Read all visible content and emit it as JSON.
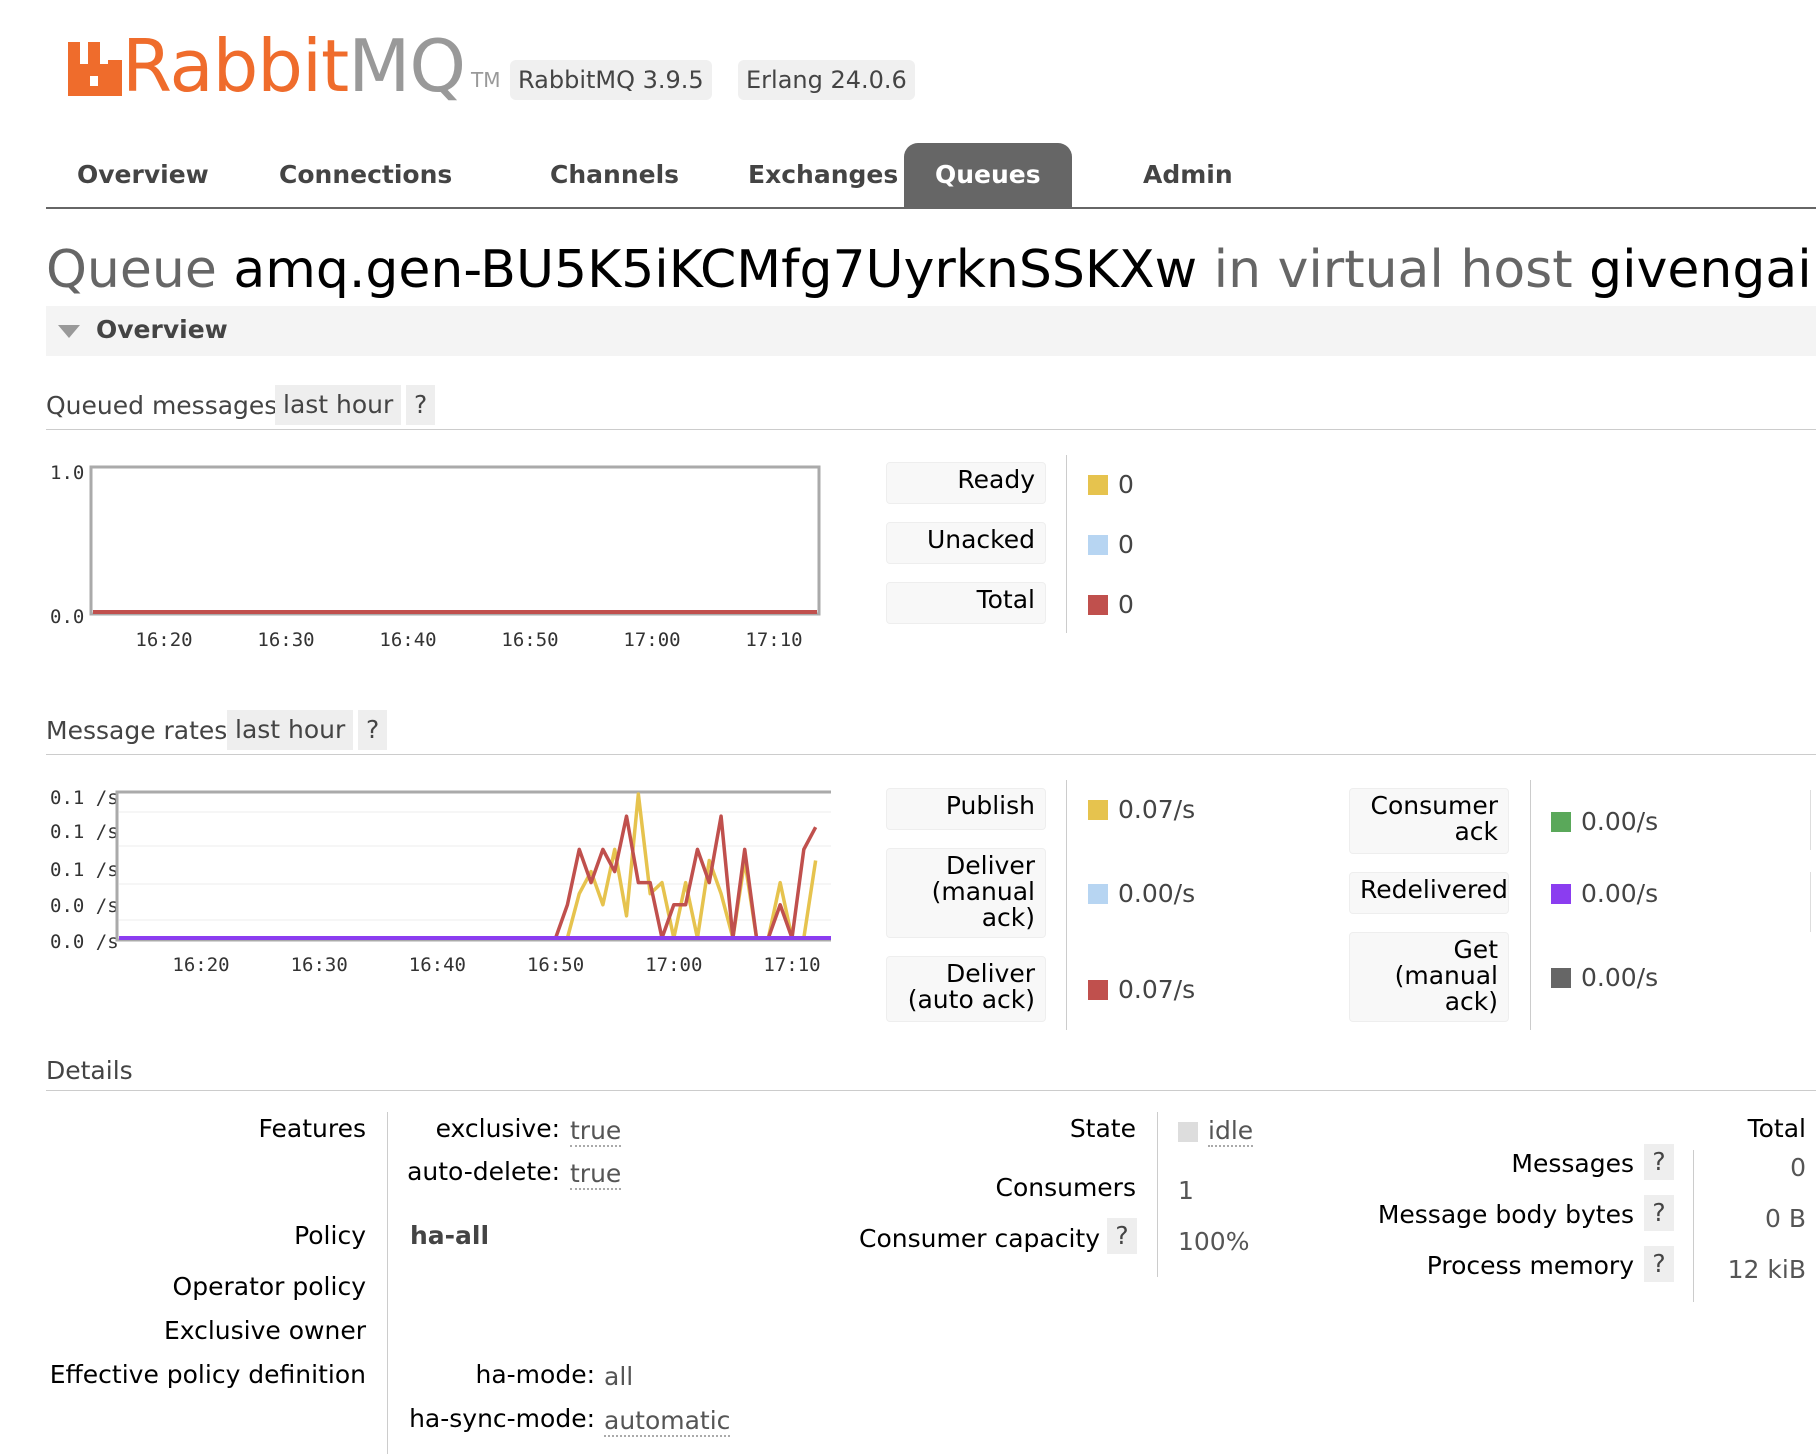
{
  "header": {
    "logo_rabbit": "Rabbit",
    "logo_mq": "MQ",
    "logo_tm": "TM",
    "rabbitmq_version": "RabbitMQ 3.9.5",
    "erlang_version": "Erlang 24.0.6"
  },
  "tabs": [
    {
      "label": "Overview"
    },
    {
      "label": "Connections"
    },
    {
      "label": "Channels"
    },
    {
      "label": "Exchanges"
    },
    {
      "label": "Queues",
      "active": true
    },
    {
      "label": "Admin"
    }
  ],
  "title": {
    "prefix": "Queue",
    "queue_name": "amq.gen-BU5K5iKCMfg7UyrknSSKXw",
    "middle": "in virtual host",
    "vhost": "givengain"
  },
  "section": {
    "label": "Overview"
  },
  "queued": {
    "label": "Queued messages",
    "range": "last hour",
    "help": "?",
    "legend": [
      {
        "label": "Ready",
        "value": "0",
        "color": "#e6c34e"
      },
      {
        "label": "Unacked",
        "value": "0",
        "color": "#b7d5f2"
      },
      {
        "label": "Total",
        "value": "0",
        "color": "#c0504d"
      }
    ]
  },
  "rates": {
    "label": "Message rates",
    "range": "last hour",
    "help": "?",
    "legend_left": [
      {
        "label": "Publish",
        "value": "0.07/s",
        "color": "#e6c34e"
      },
      {
        "label": "Deliver (manual ack)",
        "value": "0.00/s",
        "color": "#b7d5f2"
      },
      {
        "label": "Deliver (auto ack)",
        "value": "0.07/s",
        "color": "#c0504d"
      }
    ],
    "legend_right": [
      {
        "label": "Consumer ack",
        "value": "0.00/s",
        "color": "#5aa85a"
      },
      {
        "label": "Redelivered",
        "value": "0.00/s",
        "color": "#8b3df0"
      },
      {
        "label": "Get (manual ack)",
        "value": "0.00/s",
        "color": "#666666"
      }
    ]
  },
  "chart_data": [
    {
      "type": "line",
      "title": "Queued messages",
      "x": [
        "16:20",
        "16:30",
        "16:40",
        "16:50",
        "17:00",
        "17:10"
      ],
      "y_ticks": [
        "1.0",
        "0.0"
      ],
      "ylim": [
        0,
        1
      ],
      "series": [
        {
          "name": "Ready",
          "color": "#e6c34e",
          "values": [
            0,
            0,
            0,
            0,
            0,
            0
          ]
        },
        {
          "name": "Unacked",
          "color": "#b7d5f2",
          "values": [
            0,
            0,
            0,
            0,
            0,
            0
          ]
        },
        {
          "name": "Total",
          "color": "#c0504d",
          "values": [
            0,
            0,
            0,
            0,
            0,
            0
          ]
        }
      ]
    },
    {
      "type": "line",
      "title": "Message rates",
      "x_ticks": [
        "16:20",
        "16:30",
        "16:40",
        "16:50",
        "17:00",
        "17:10"
      ],
      "y_ticks": [
        "0.1 /s",
        "0.1 /s",
        "0.1 /s",
        "0.0 /s",
        "0.0 /s"
      ],
      "ylim": [
        0,
        0.13
      ],
      "x_minutes_range": [
        16.2,
        17.213
      ],
      "series": [
        {
          "name": "Publish",
          "color": "#e6c34e",
          "points": [
            [
              16.51,
              0
            ],
            [
              16.52,
              0.04
            ],
            [
              16.53,
              0.06
            ],
            [
              16.54,
              0.03
            ],
            [
              16.55,
              0.08
            ],
            [
              16.56,
              0.02
            ],
            [
              16.57,
              0.13
            ],
            [
              16.58,
              0.04
            ],
            [
              16.59,
              0.05
            ],
            [
              17.0,
              0.0
            ],
            [
              17.01,
              0.05
            ],
            [
              17.02,
              0.0
            ],
            [
              17.03,
              0.07
            ],
            [
              17.04,
              0.04
            ],
            [
              17.05,
              0.0
            ],
            [
              17.06,
              0.07
            ],
            [
              17.07,
              0.0
            ],
            [
              17.08,
              0.0
            ],
            [
              17.09,
              0.05
            ],
            [
              17.1,
              0.0
            ],
            [
              17.11,
              0.0
            ],
            [
              17.123,
              0.07
            ]
          ]
        },
        {
          "name": "Deliver (auto ack)",
          "color": "#c0504d",
          "points": [
            [
              16.5,
              0
            ],
            [
              16.51,
              0.03
            ],
            [
              16.52,
              0.08
            ],
            [
              16.53,
              0.05
            ],
            [
              16.54,
              0.08
            ],
            [
              16.55,
              0.06
            ],
            [
              16.56,
              0.11
            ],
            [
              16.57,
              0.05
            ],
            [
              16.58,
              0.05
            ],
            [
              16.59,
              0.0
            ],
            [
              17.0,
              0.03
            ],
            [
              17.01,
              0.03
            ],
            [
              17.02,
              0.08
            ],
            [
              17.03,
              0.05
            ],
            [
              17.04,
              0.11
            ],
            [
              17.05,
              0.0
            ],
            [
              17.06,
              0.08
            ],
            [
              17.07,
              0.0
            ],
            [
              17.08,
              0.0
            ],
            [
              17.09,
              0.03
            ],
            [
              17.1,
              0.0
            ],
            [
              17.11,
              0.08
            ],
            [
              17.123,
              0.1
            ]
          ]
        },
        {
          "name": "Redelivered",
          "color": "#8b3df0",
          "points": [
            [
              16.2,
              0
            ],
            [
              17.123,
              0
            ]
          ]
        }
      ]
    }
  ],
  "details": {
    "label": "Details",
    "features_label": "Features",
    "features": [
      {
        "key": "exclusive:",
        "value": "true"
      },
      {
        "key": "auto-delete:",
        "value": "true"
      }
    ],
    "policy_label": "Policy",
    "policy_value": "ha-all",
    "operator_policy_label": "Operator policy",
    "exclusive_owner_label": "Exclusive owner",
    "effective_policy_label": "Effective policy definition",
    "effective_policy": [
      {
        "key": "ha-mode:",
        "value": "all"
      },
      {
        "key": "ha-sync-mode:",
        "value": "automatic"
      }
    ],
    "state_label": "State",
    "state_value": "idle",
    "consumers_label": "Consumers",
    "consumers_value": "1",
    "consumer_capacity_label": "Consumer capacity",
    "consumer_capacity_value": "100%",
    "total_header": "Total",
    "stats": [
      {
        "label": "Messages",
        "value": "0"
      },
      {
        "label": "Message body bytes",
        "value": "0 B"
      },
      {
        "label": "Process memory",
        "value": "12 kiB"
      }
    ],
    "help": "?"
  }
}
